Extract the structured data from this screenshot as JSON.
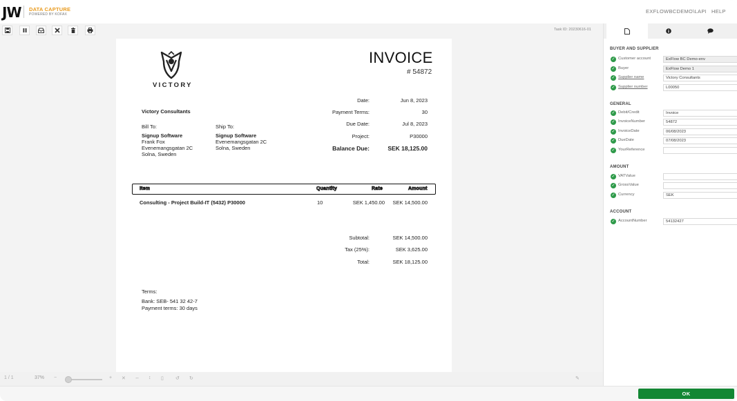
{
  "header": {
    "logo_mark": "JW",
    "logo_title": "DATA CAPTURE",
    "logo_subtitle": "POWERED BY KOFAX",
    "user": "EXFLOWBCDEMO\\LAPI",
    "help": "HELP"
  },
  "toolbar": {
    "task_id": "Task ID: 20230616-01",
    "icons": [
      "save-icon",
      "pause-icon",
      "inbox-icon",
      "close-icon",
      "trash-icon",
      "print-icon"
    ]
  },
  "invoice": {
    "logo_text": "VICTORY",
    "title": "INVOICE",
    "number": "# 54872",
    "from_name": "Victory Consultants",
    "bill_to_label": "Bill To:",
    "bill_to_lines": [
      "Signup Software",
      "Frank Fox",
      "Evenemangsgatan 2C",
      "Solna, Sweden"
    ],
    "ship_to_label": "Ship To:",
    "ship_to_lines": [
      "Signup Software",
      "Evenemangsgatan 2C",
      "Solna, Sweden"
    ],
    "meta": [
      {
        "label": "Date:",
        "value": "Jun 8, 2023"
      },
      {
        "label": "Payment Terms:",
        "value": "30"
      },
      {
        "label": "Due Date:",
        "value": "Jul 8, 2023"
      },
      {
        "label": "Project:",
        "value": "P30000"
      },
      {
        "label": "Balance Due:",
        "value": "SEK 18,125.00"
      }
    ],
    "columns": [
      "Item",
      "Quantity",
      "Rate",
      "Amount"
    ],
    "items": [
      {
        "item": "Consulting - Project Build-IT (5432) P30000",
        "quantity": "10",
        "rate": "SEK 1,450.00",
        "amount": "SEK 14,500.00"
      }
    ],
    "totals": [
      {
        "label": "Subtotal:",
        "value": "SEK 14,500.00"
      },
      {
        "label": "Tax (25%):",
        "value": "SEK 3,625.00"
      },
      {
        "label": "Total:",
        "value": "SEK 18,125.00"
      }
    ],
    "terms_label": "Terms:",
    "terms_lines": [
      "Bank: SEB- 541 32 42-7",
      "Payment terms: 30 days"
    ]
  },
  "viewer_bar": {
    "page_nav": "1 / 1",
    "zoom_level": "37%",
    "zoom_minus": "−",
    "zoom_plus": "+"
  },
  "panel": {
    "tab_icons": [
      "document-icon",
      "info-icon",
      "comment-icon"
    ],
    "sections": [
      {
        "title": "BUYER AND SUPPLIER",
        "fields": [
          {
            "label": "Customer account",
            "value": "ExFlow BC Demo-env",
            "link": false,
            "readonly": true
          },
          {
            "label": "Buyer",
            "value": "ExFlow Demo 1",
            "link": false,
            "readonly": true
          },
          {
            "label": "Supplier name",
            "value": "Victory Consultants",
            "link": true,
            "readonly": false
          },
          {
            "label": "Supplier number",
            "value": "L00050",
            "link": true,
            "readonly": false
          }
        ]
      },
      {
        "title": "GENERAL",
        "fields": [
          {
            "label": "Debit/Credit",
            "value": "Invoice",
            "link": false,
            "readonly": false
          },
          {
            "label": "InvoiceNumber",
            "value": "54872",
            "link": false,
            "readonly": false
          },
          {
            "label": "InvoiceDate",
            "value": "06/08/2023",
            "link": false,
            "readonly": false
          },
          {
            "label": "DueDate",
            "value": "07/08/2023",
            "link": false,
            "readonly": false
          },
          {
            "label": "YourReference",
            "value": "",
            "link": false,
            "readonly": false
          }
        ]
      },
      {
        "title": "AMOUNT",
        "fields": [
          {
            "label": "VATValue",
            "value": "",
            "link": false,
            "readonly": false
          },
          {
            "label": "GrossValue",
            "value": "",
            "link": false,
            "readonly": false
          },
          {
            "label": "Currency",
            "value": "SEK",
            "link": false,
            "readonly": false
          }
        ]
      },
      {
        "title": "ACCOUNT",
        "fields": [
          {
            "label": "AccountNumber",
            "value": "54132427",
            "link": false,
            "readonly": false
          }
        ]
      }
    ]
  },
  "footer": {
    "ok_label": "OK"
  },
  "colors": {
    "brand_accent": "#e99b1f",
    "ok_green": "#138734",
    "check_green": "#2e9a49"
  }
}
